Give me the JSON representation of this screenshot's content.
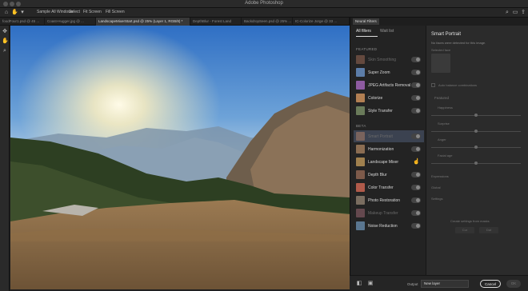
{
  "window": {
    "title": "Adobe Photoshop"
  },
  "options_bar": {
    "items": [
      "Sample All Windows",
      "Select",
      "Fit Screen",
      "Fill Screen"
    ]
  },
  "document_tabs": [
    "foodFour1.psd @ 45 ...",
    "Coast-Hugger.jpg @ ...",
    "LandscapeMixerStart.psd @ 25% (Layer 1, RGB/8) *",
    "DepthBlur - Forest Land",
    "BackdropSeen.psd @ 25% ...",
    "IC-Colorize Jorge @ 33 ..."
  ],
  "neural_filters": {
    "panel_tab": "Neural Filters",
    "sub_tabs": [
      "All filters",
      "Wait list"
    ],
    "sections": {
      "featured": "FEATURED",
      "beta": "BETA"
    },
    "featured": [
      {
        "label": "Skin Smoothing",
        "dim": true,
        "thumb": "#a5705a"
      },
      {
        "label": "Super Zoom",
        "dim": false,
        "thumb": "#5c7da8"
      },
      {
        "label": "JPEG Artifacts Removal",
        "dim": false,
        "thumb": "#8e5ba1"
      },
      {
        "label": "Colorize",
        "dim": false,
        "thumb": "#b27f52"
      },
      {
        "label": "Style Transfer",
        "dim": false,
        "thumb": "#6a7b5a"
      }
    ],
    "beta": [
      {
        "label": "Smart Portrait",
        "dim": true,
        "selected": true,
        "thumb": "#b8846a"
      },
      {
        "label": "Harmonization",
        "dim": false,
        "thumb": "#8b6d52"
      },
      {
        "label": "Landscape Mixer",
        "dim": false,
        "hover": true,
        "thumb": "#a0804e"
      },
      {
        "label": "Depth Blur",
        "dim": false,
        "thumb": "#7d5a4a"
      },
      {
        "label": "Color Transfer",
        "dim": false,
        "thumb": "#b05a4a"
      },
      {
        "label": "Photo Restoration",
        "dim": false,
        "thumb": "#7a6d60"
      },
      {
        "label": "Makeup Transfer",
        "dim": true,
        "thumb": "#a66d7a"
      },
      {
        "label": "Noise Reduction",
        "dim": false,
        "thumb": "#5a7690"
      }
    ],
    "settings": {
      "title": "Smart Portrait",
      "note": "No faces were detected for this image.",
      "selected_face_label": "Selected face",
      "auto_balance_label": "Auto balance combinations",
      "featured_label": "Featured",
      "sliders": [
        "Happiness",
        "Surprise",
        "Anger",
        "Facial age"
      ],
      "groups": [
        "Expressions",
        "Global",
        "Settings"
      ],
      "mask_label": "Create settings from masks",
      "buttons": [
        "Cur",
        "Dat"
      ]
    }
  },
  "bottom_bar": {
    "output_label": "Output",
    "output_value": "New layer",
    "cancel_label": "Cancel",
    "ok_label": "OK"
  },
  "colors": {
    "accent": "#3b4250",
    "panel": "#282828",
    "background": "#1b1b1b"
  }
}
